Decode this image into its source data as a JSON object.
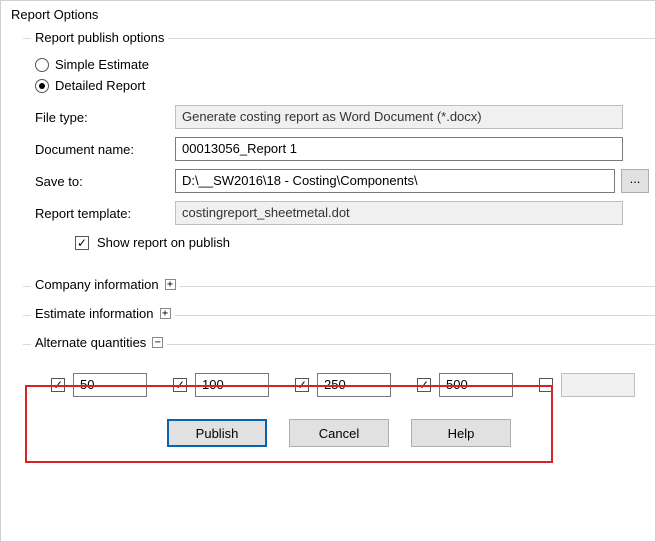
{
  "window": {
    "title": "Report Options"
  },
  "group_publish": {
    "legend": "Report publish options"
  },
  "radios": {
    "simple": "Simple Estimate",
    "detailed": "Detailed Report"
  },
  "labels": {
    "file_type": "File type:",
    "document_name": "Document name:",
    "save_to": "Save to:",
    "report_template": "Report template:",
    "show_on_publish": "Show report on publish",
    "browse": "..."
  },
  "fields": {
    "file_type_value": "Generate costing report as Word Document (*.docx)",
    "document_name_value": "00013056_Report 1",
    "save_to_value": "D:\\__SW2016\\18 - Costing\\Components\\",
    "report_template_value": "costingreport_sheetmetal.dot"
  },
  "sections": {
    "company": "Company information",
    "estimate": "Estimate information",
    "alt_qty": "Alternate quantities"
  },
  "qty": {
    "q1": "50",
    "q2": "100",
    "q3": "250",
    "q4": "500",
    "q5": ""
  },
  "buttons": {
    "publish": "Publish",
    "cancel": "Cancel",
    "help": "Help"
  },
  "glyph": {
    "plus": "+",
    "minus": "−"
  }
}
